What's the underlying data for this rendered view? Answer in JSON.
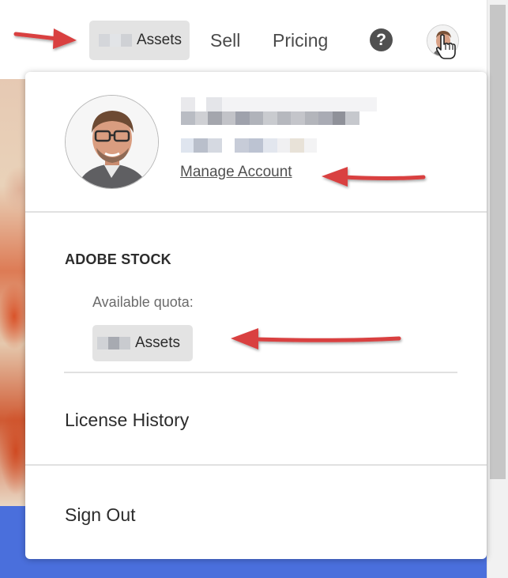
{
  "nav": {
    "assets_label": "Assets",
    "sell_label": "Sell",
    "pricing_label": "Pricing",
    "help_glyph": "?"
  },
  "account": {
    "manage_account_label": "Manage Account"
  },
  "stock": {
    "section_title": "ADOBE STOCK",
    "quota_label": "Available quota:",
    "quota_unit_label": "Assets"
  },
  "menu": {
    "license_history_label": "License History",
    "sign_out_label": "Sign Out"
  },
  "colors": {
    "annotation_arrow": "#d94040",
    "pill_background": "#e3e3e3",
    "footer_band": "#4a6fdc"
  },
  "icons": {
    "help": "question-circle-icon",
    "cursor": "hand-pointer-icon"
  }
}
